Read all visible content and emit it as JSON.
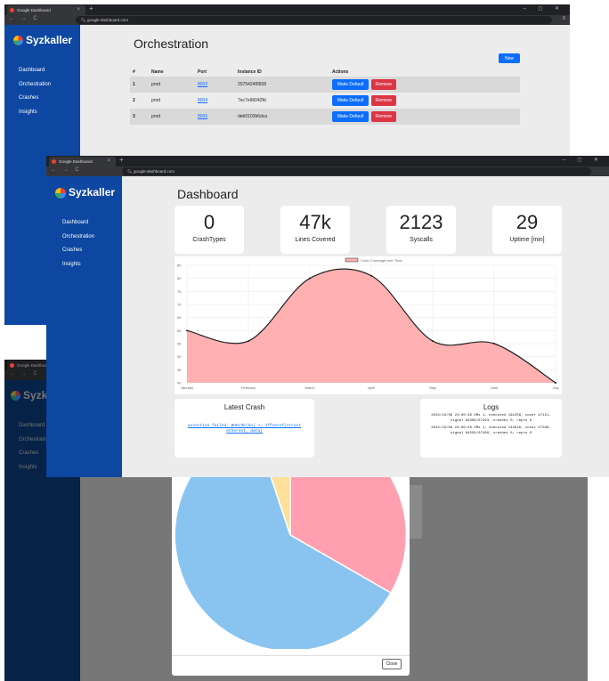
{
  "browser": {
    "tab_title": "Google Dashboard",
    "url": "google-dashboard.com",
    "nav_buttons": "← → C",
    "window_controls": "– ◻ ✕"
  },
  "brand": {
    "name": "Syzkaller",
    "partial_name": "Syzk"
  },
  "sidebar": {
    "items": [
      {
        "label": "Dashboard"
      },
      {
        "label": "Orchestration"
      },
      {
        "label": "Crashes"
      },
      {
        "label": "Insights"
      }
    ],
    "partial_items": [
      {
        "label": "Dashboard"
      },
      {
        "label": "Orchestratio"
      },
      {
        "label": "Crashes"
      },
      {
        "label": "Insights"
      }
    ]
  },
  "orchestration": {
    "title": "Orchestration",
    "new_button": "New",
    "columns": [
      "#",
      "Name",
      "Port",
      "Instance ID",
      "Actions"
    ],
    "rows": [
      {
        "num": "1",
        "name": "prod",
        "port": "8003",
        "instance": "2075424f9558"
      },
      {
        "num": "2",
        "name": "prod",
        "port": "8004",
        "instance": "7ec7e96042fd"
      },
      {
        "num": "3",
        "name": "prod",
        "port": "8005",
        "instance": "deb0103b6dca"
      }
    ],
    "make_default": "Make Default",
    "remove": "Remove"
  },
  "dashboard": {
    "title": "Dashboard",
    "stats": [
      {
        "value": "0",
        "label": "CrashTypes"
      },
      {
        "value": "47k",
        "label": "Lines Covered"
      },
      {
        "value": "2123",
        "label": "Syscalls"
      },
      {
        "value": "29",
        "label": "Uptime [min]"
      }
    ],
    "latest_crash_title": "Latest Crash",
    "latest_crash_text": "assertion failed: BUG(Ok(ba) >= offsetof(struct ethernet, data)",
    "logs_title": "Logs",
    "logs": [
      "2022/10/06 23:00:46 VMs 1, executed 191256, cover 47121, signal 64309/67293, crashes 0, repro 0",
      "2022/10/06 23:00:56 VMs 1, executed 143546, cover 47296, signal 64559/67480, crashes 0, repro 0"
    ]
  },
  "crashes_modal": {
    "close_label": "Close"
  },
  "chart_data": {
    "type": "area",
    "legend": "Code Coverage over Time",
    "categories": [
      "January",
      "February",
      "March",
      "April",
      "May",
      "June",
      "July"
    ],
    "values": [
      60,
      56,
      80,
      81,
      56,
      55,
      40
    ],
    "ylim": [
      40,
      85
    ],
    "yticks": [
      "85",
      "80",
      "75",
      "70",
      "65",
      "60",
      "55",
      "50",
      "45",
      "40"
    ],
    "colors": {
      "fill": "#ffb1b1",
      "line": "#222222"
    }
  },
  "pie_chart": {
    "type": "pie",
    "colors": [
      "#ff9fb0",
      "#89c4f0",
      "#ffdf99"
    ]
  }
}
